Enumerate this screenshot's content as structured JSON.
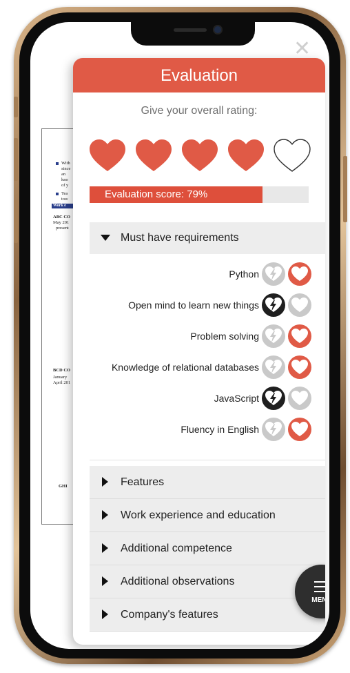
{
  "colors": {
    "accent": "#e05a46",
    "dark": "#2e2e2e",
    "muted": "#c9c9c9"
  },
  "panel": {
    "title": "Evaluation",
    "rating_prompt": "Give your overall rating:",
    "rating": {
      "filled": 4,
      "total": 5
    },
    "score": {
      "label": "Evaluation score: 79%",
      "fraction": 0.79
    }
  },
  "requirements": {
    "title": "Must have requirements",
    "items": [
      {
        "label": "Python",
        "state": "liked"
      },
      {
        "label": "Open mind to learn new things",
        "state": "disliked"
      },
      {
        "label": "Problem solving",
        "state": "liked"
      },
      {
        "label": "Knowledge of relational databases",
        "state": "liked"
      },
      {
        "label": "JavaScript",
        "state": "disliked"
      },
      {
        "label": "Fluency in English",
        "state": "liked"
      }
    ]
  },
  "sections": [
    "Features",
    "Work experience and education",
    "Additional competence",
    "Additional observations",
    "Company's features"
  ],
  "menu": {
    "label": "MENU",
    "icon": "hamburger-icon"
  },
  "close_icon": "close-icon",
  "document": {
    "lines": [
      "With",
      "since",
      "an",
      "kno",
      "of y",
      "Tea",
      "tow",
      "ABC CO",
      "May 201",
      "present",
      "BCD CO",
      "January",
      "April 201",
      "GHI"
    ],
    "heading": "Work e"
  }
}
